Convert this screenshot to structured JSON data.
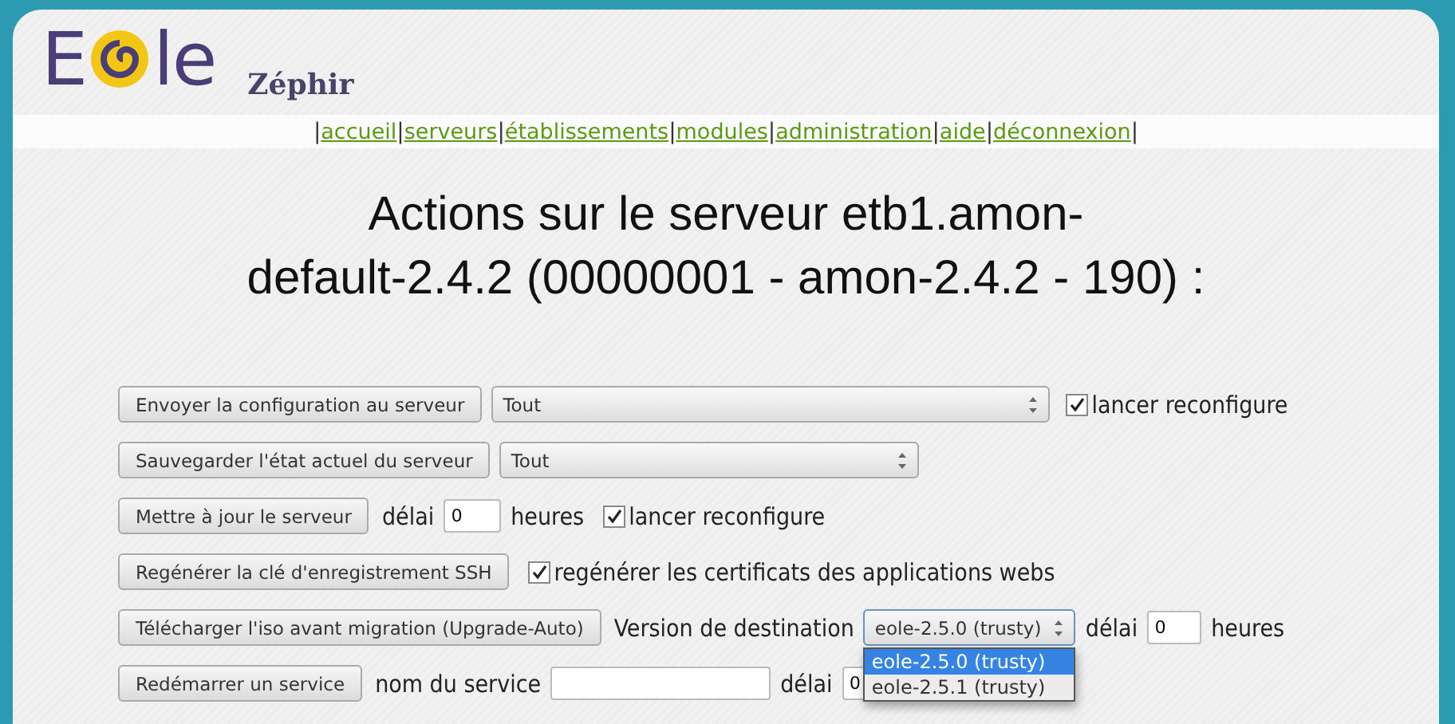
{
  "logo": {
    "before": "E",
    "after": "le"
  },
  "app_name": "Zéphir",
  "nav": {
    "separator": "|",
    "links": [
      "accueil",
      "serveurs",
      "établissements",
      "modules",
      "administration",
      "aide",
      "déconnexion"
    ]
  },
  "title_lines": [
    "Actions sur le serveur etb1.amon-",
    "default-2.4.2 (00000001 - amon-2.4.2 - 190) :"
  ],
  "rows": [
    {
      "button": "Envoyer la configuration au serveur",
      "items": [
        {
          "kind": "select",
          "value": "Tout",
          "open": false
        },
        {
          "kind": "checkbox",
          "label": "lancer reconfigure",
          "checked": true
        }
      ]
    },
    {
      "button": "Sauvegarder l'état actuel du serveur",
      "items": [
        {
          "kind": "select",
          "value": "Tout",
          "open": false
        }
      ]
    },
    {
      "button": "Mettre à jour le serveur",
      "items": [
        {
          "kind": "text",
          "label": "délai"
        },
        {
          "kind": "input",
          "value": "0"
        },
        {
          "kind": "text",
          "label": "heures"
        },
        {
          "kind": "checkbox",
          "label": "lancer reconfigure",
          "checked": true
        }
      ]
    },
    {
      "button": "Regénérer la clé d'enregistrement SSH",
      "items": [
        {
          "kind": "checkbox",
          "label": "regénérer les certificats des applications webs",
          "checked": true
        }
      ]
    },
    {
      "button": "Télécharger l'iso avant migration (Upgrade-Auto)",
      "items": [
        {
          "kind": "text",
          "label": "Version de destination"
        },
        {
          "kind": "select",
          "value": "eole-2.5.0 (trusty)",
          "open": true,
          "options": [
            {
              "label": "eole-2.5.0 (trusty)",
              "selected": true
            },
            {
              "label": "eole-2.5.1 (trusty)",
              "selected": false
            }
          ]
        },
        {
          "kind": "text",
          "label": "délai"
        },
        {
          "kind": "input",
          "value": "0"
        },
        {
          "kind": "text",
          "label": "heures"
        }
      ]
    },
    {
      "button": "Redémarrer un service",
      "items": [
        {
          "kind": "text",
          "label": "nom du service"
        },
        {
          "kind": "input",
          "value": ""
        },
        {
          "kind": "text",
          "label": "délai"
        },
        {
          "kind": "input",
          "value": "0"
        }
      ]
    }
  ]
}
